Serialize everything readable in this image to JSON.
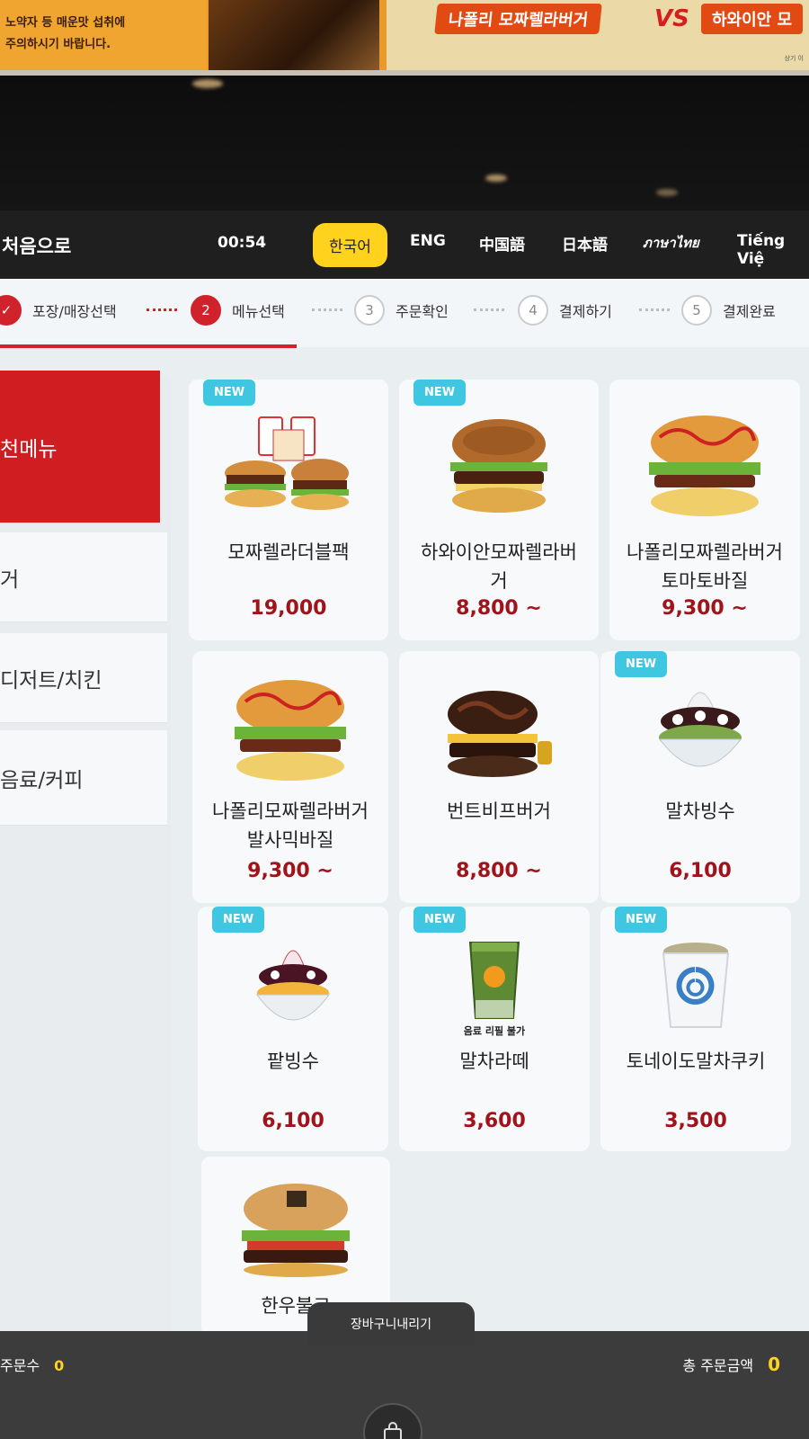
{
  "banner": {
    "left_line1": "노약자 등 매운맛 섭취에",
    "left_line2": "주의하시기 바랍니다.",
    "promo_left": "나폴리 모짜렐라버거",
    "promo_vs": "VS",
    "promo_right": "하와이안 모",
    "fine_print": "상기 이"
  },
  "header": {
    "home_label": "처음으로",
    "timer": "00:54",
    "languages": [
      "한국어",
      "ENG",
      "中国語",
      "日本語",
      "ภาษาไทย",
      "Tiếng Việ"
    ],
    "active_language": "한국어"
  },
  "steps": [
    {
      "num": "✓",
      "label": "포장/매장선택",
      "state": "done"
    },
    {
      "num": "2",
      "label": "메뉴선택",
      "state": "current"
    },
    {
      "num": "3",
      "label": "주문확인",
      "state": "pending"
    },
    {
      "num": "4",
      "label": "결제하기",
      "state": "pending"
    },
    {
      "num": "5",
      "label": "결제완료",
      "state": "pending"
    }
  ],
  "categories": [
    "천메뉴",
    "거",
    "디저트/치킨",
    "음료/커피"
  ],
  "products": [
    {
      "name": "모짜렐라더블팩",
      "price": "19,000",
      "badge": "NEW"
    },
    {
      "name": "하와이안모짜렐라버거",
      "price": "8,800 ~",
      "badge": "NEW"
    },
    {
      "name": "나폴리모짜렐라버거토마토바질",
      "price": "9,300 ~",
      "badge": ""
    },
    {
      "name": "나폴리모짜렐라버거발사믹바질",
      "price": "9,300 ~",
      "badge": ""
    },
    {
      "name": "번트비프버거",
      "price": "8,800 ~",
      "badge": ""
    },
    {
      "name": "말차빙수",
      "price": "6,100",
      "badge": "NEW"
    },
    {
      "name": "팥빙수",
      "price": "6,100",
      "badge": "NEW"
    },
    {
      "name": "말차라떼",
      "price": "3,600",
      "badge": "NEW",
      "note": "음료 리필 불가"
    },
    {
      "name": "토네이도말차쿠키",
      "price": "3,500",
      "badge": "NEW"
    },
    {
      "name": "한우불고",
      "price": "",
      "badge": ""
    }
  ],
  "cart_tab": "장바구니내리기",
  "bottom": {
    "order_count_label": "주문수",
    "order_count": "0",
    "total_label": "총 주문금액",
    "total_amount": "0"
  },
  "colors": {
    "brand_red": "#cf1d22",
    "accent_yellow": "#ffd21e",
    "new_badge": "#3fc6e0",
    "price_red": "#a0131a"
  }
}
